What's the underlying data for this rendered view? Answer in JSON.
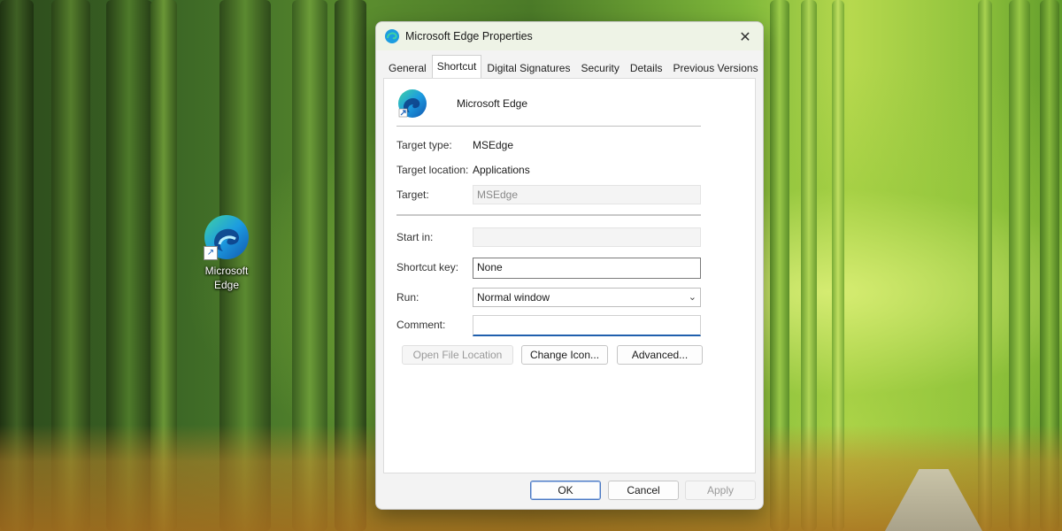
{
  "desktop": {
    "icon_label": "Microsoft Edge",
    "icon": "edge-logo-icon"
  },
  "dialog": {
    "title": "Microsoft Edge Properties",
    "close_icon": "close-icon",
    "tabs": [
      "General",
      "Shortcut",
      "Digital Signatures",
      "Security",
      "Details",
      "Previous Versions"
    ],
    "active_tab": "Shortcut",
    "app_name": "Microsoft Edge",
    "target_type_label": "Target type:",
    "target_type_value": "MSEdge",
    "target_location_label": "Target location:",
    "target_location_value": "Applications",
    "target_label": "Target:",
    "target_value": "MSEdge",
    "start_in_label": "Start in:",
    "start_in_value": "",
    "shortcut_key_label": "Shortcut key:",
    "shortcut_key_value": "None",
    "run_label": "Run:",
    "run_value": "Normal window",
    "comment_label": "Comment:",
    "comment_value": "",
    "open_file_location_label": "Open File Location",
    "change_icon_label": "Change Icon...",
    "advanced_label": "Advanced...",
    "ok_label": "OK",
    "cancel_label": "Cancel",
    "apply_label": "Apply"
  },
  "colors": {
    "accent": "#1f5fad"
  }
}
